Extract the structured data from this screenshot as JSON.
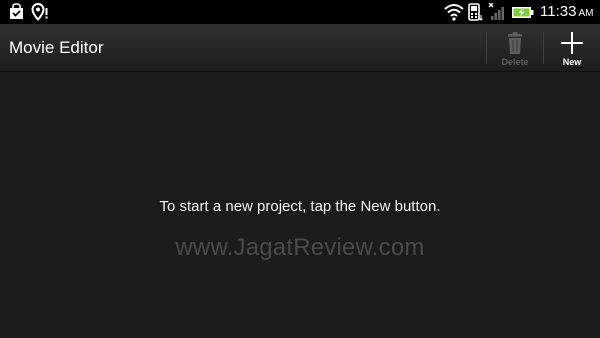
{
  "status_bar": {
    "icons": [
      "shopping-bag-icon",
      "location-pin-icon",
      "wifi-icon",
      "phone-data-icon",
      "no-signal-icon",
      "battery-charging-icon"
    ],
    "time": "11:33",
    "ampm": "AM",
    "battery_color": "#7ccf3a"
  },
  "action_bar": {
    "title": "Movie Editor",
    "delete_label": "Delete",
    "new_label": "New"
  },
  "content": {
    "empty_message": "To start a new project, tap the New button.",
    "watermark": "www.JagatReview.com"
  },
  "colors": {
    "background": "#1b1b1b",
    "disabled": "#5d5d5d"
  }
}
